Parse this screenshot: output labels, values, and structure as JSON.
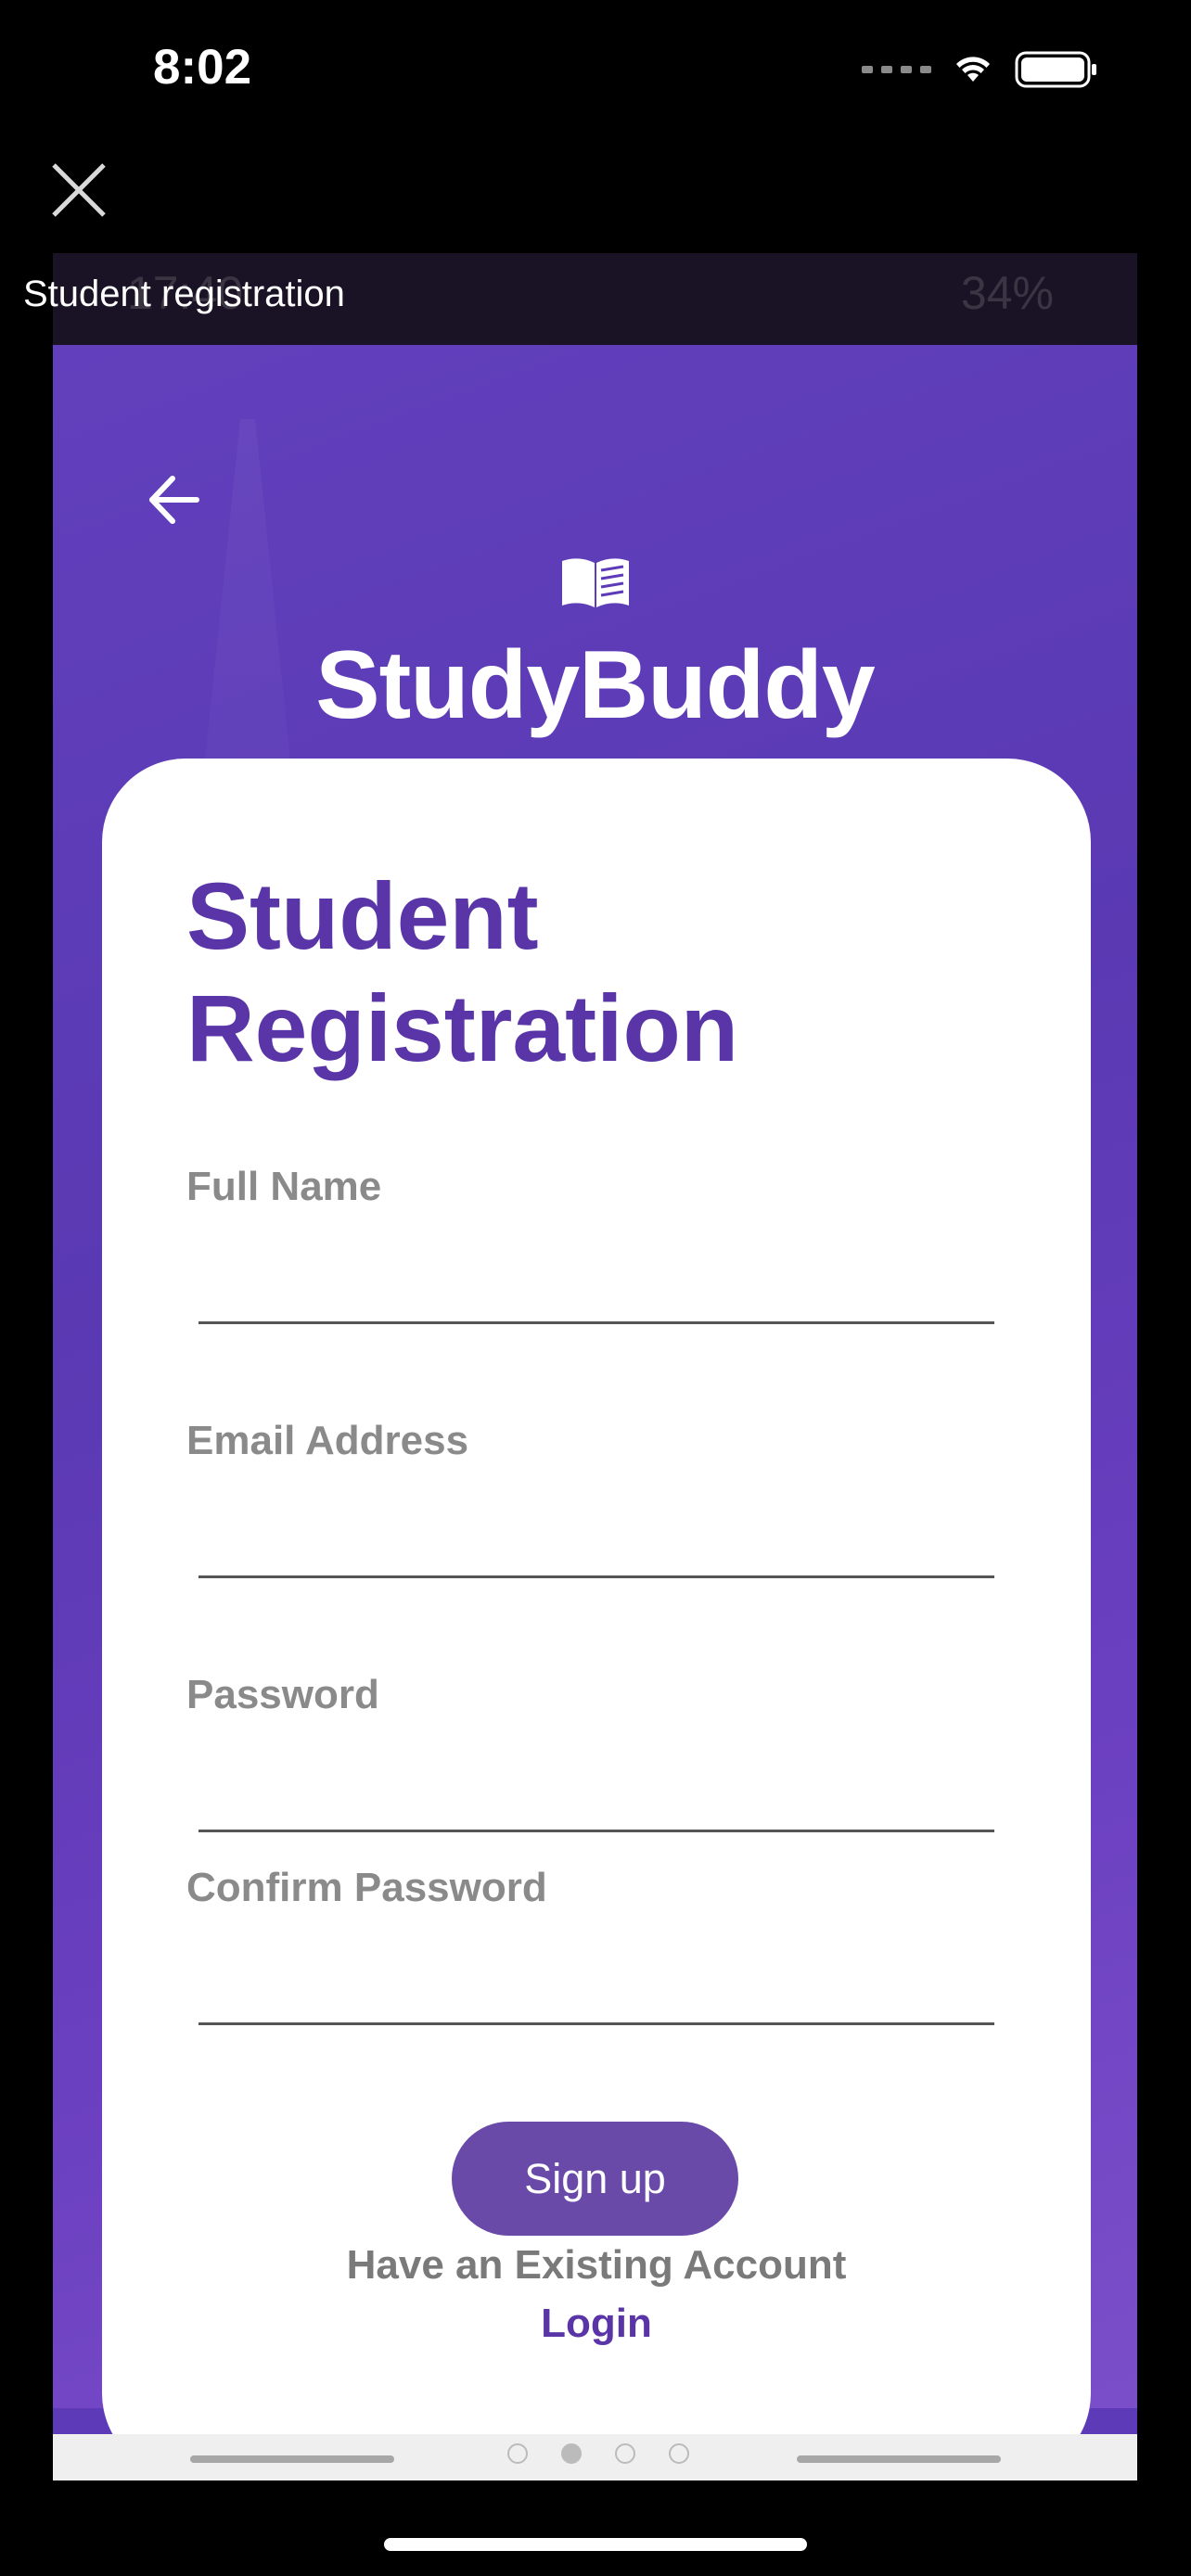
{
  "ios_status": {
    "time": "8:02"
  },
  "viewer": {
    "caption": "Student registration"
  },
  "android_status": {
    "time": "17:40",
    "battery": "34%"
  },
  "app": {
    "brand": "StudyBuddy",
    "icons": {
      "back": "arrow-left-icon",
      "logo": "open-book-icon",
      "close": "close-icon"
    },
    "colors": {
      "primary": "#5d3bb8",
      "title": "#5a35a8",
      "button": "#6a4aa8"
    }
  },
  "form": {
    "title": "Student Registration",
    "fields": [
      {
        "label": "Full Name",
        "value": ""
      },
      {
        "label": "Email Address",
        "value": ""
      },
      {
        "label": "Password",
        "value": ""
      },
      {
        "label": "Confirm Password",
        "value": ""
      }
    ],
    "submit_label": "Sign up",
    "existing_account_text": "Have an Existing Account",
    "login_label": "Login"
  }
}
